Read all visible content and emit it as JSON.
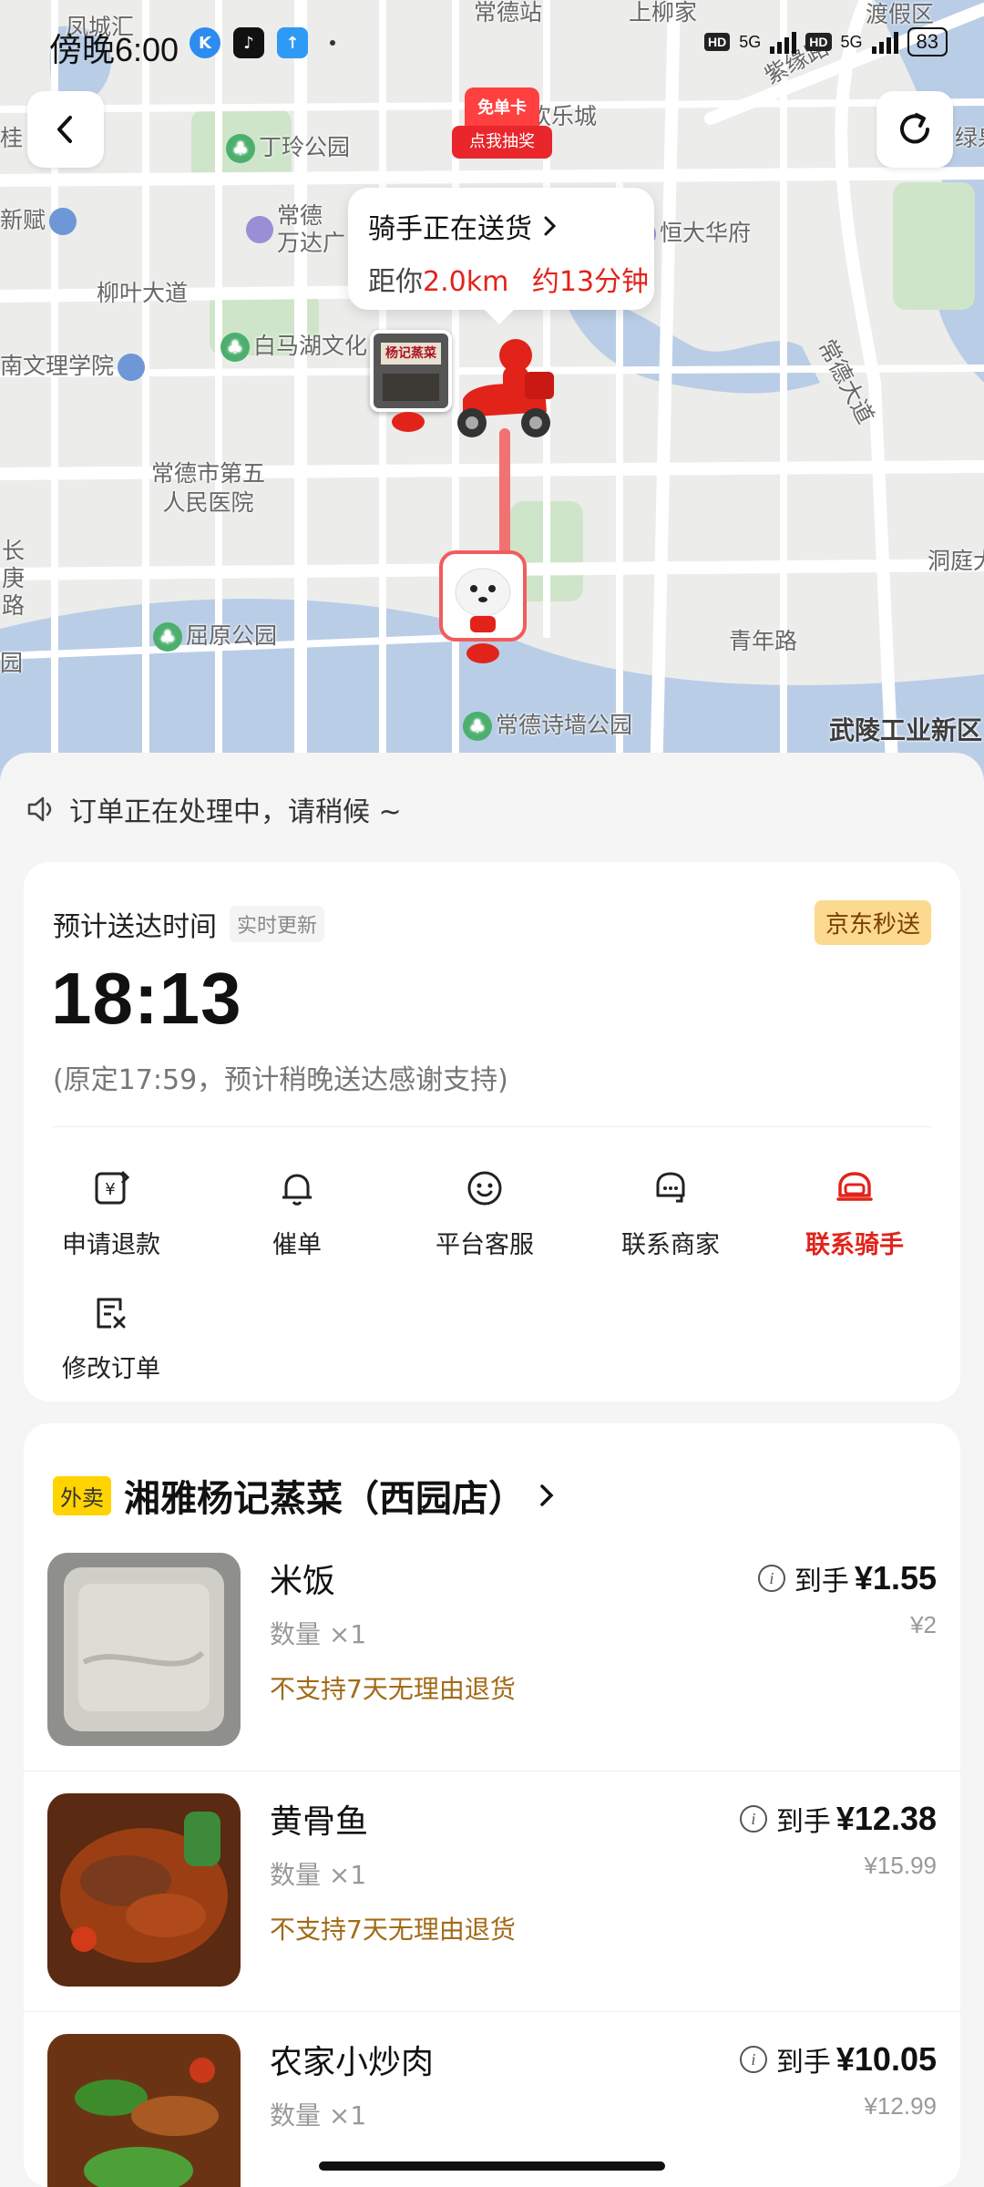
{
  "status_bar": {
    "time": "傍晚6:00",
    "hd1": "HD",
    "net1": "5G",
    "hd2": "HD",
    "net2": "5G",
    "battery": "83"
  },
  "map": {
    "labels": {
      "fengchenghui": "凤城汇",
      "changdezhan": "常德站",
      "shangliujia": "上柳家",
      "dujiaqu": "渡假区",
      "ziyuanlu": "紫缘路",
      "gui": "桂",
      "dinglinggongyuan": "丁玲公园",
      "huanlecheng": "欢乐城",
      "luquan": "绿泉",
      "xinfu": "新赋",
      "changdewanda": "常德\n万达广",
      "hengdahuafu": "恒大华府",
      "liuyedadao": "柳叶大道",
      "baimahu": "白马湖文化",
      "nanwenli": "南文理学院",
      "changdedadao": "常德大道",
      "fifth_hospital": "常德市第五\n人民医院",
      "changgenglu": "长\n庚\n路",
      "qinglu": "洞庭大",
      "quyuan": "屈原公园",
      "qingnianlu": "青年路",
      "shiqianggongyuan": "常德诗墙公园",
      "wulingindustry": "武陵工业新区",
      "yuan": "园"
    },
    "promo_top": "免单卡",
    "promo_bottom": "点我抽奖",
    "store_sign": "杨记蒸菜",
    "bubble": {
      "title": "骑手正在送货",
      "distance_prefix": "距你",
      "distance": "2.0km",
      "eta": "约13分钟"
    }
  },
  "notice": "订单正在处理中，请稍候 ~",
  "delivery": {
    "eta_label": "预计送达时间",
    "realtime_tag": "实时更新",
    "service_badge": "京东秒送",
    "eta_time": "18:13",
    "eta_note": "(原定17:59，预计稍晚送达感谢支持)",
    "actions": [
      {
        "label": "申请退款",
        "icon": "refund-icon"
      },
      {
        "label": "催单",
        "icon": "bell-icon"
      },
      {
        "label": "平台客服",
        "icon": "smile-icon"
      },
      {
        "label": "联系商家",
        "icon": "merchant-chat-icon"
      },
      {
        "label": "联系骑手",
        "icon": "rider-helmet-icon"
      },
      {
        "label": "修改订单",
        "icon": "edit-order-icon"
      }
    ]
  },
  "store": {
    "tag": "外卖",
    "name": "湘雅杨记蒸菜（西园店）",
    "items": [
      {
        "name": "米饭",
        "qty": "数量 ×1",
        "policy": "不支持7天无理由退货",
        "price_label": "到手",
        "price": "¥1.55",
        "original": "¥2"
      },
      {
        "name": "黄骨鱼",
        "qty": "数量 ×1",
        "policy": "不支持7天无理由退货",
        "price_label": "到手",
        "price": "¥12.38",
        "original": "¥15.99"
      },
      {
        "name": "农家小炒肉",
        "qty": "数量 ×1",
        "policy": "",
        "price_label": "到手",
        "price": "¥10.05",
        "original": "¥12.99"
      }
    ]
  },
  "colors": {
    "accent_red": "#e2231a",
    "policy_brown": "#a26a16",
    "badge_gold": "#fbd98e",
    "takeout_yellow": "#ffd400"
  }
}
